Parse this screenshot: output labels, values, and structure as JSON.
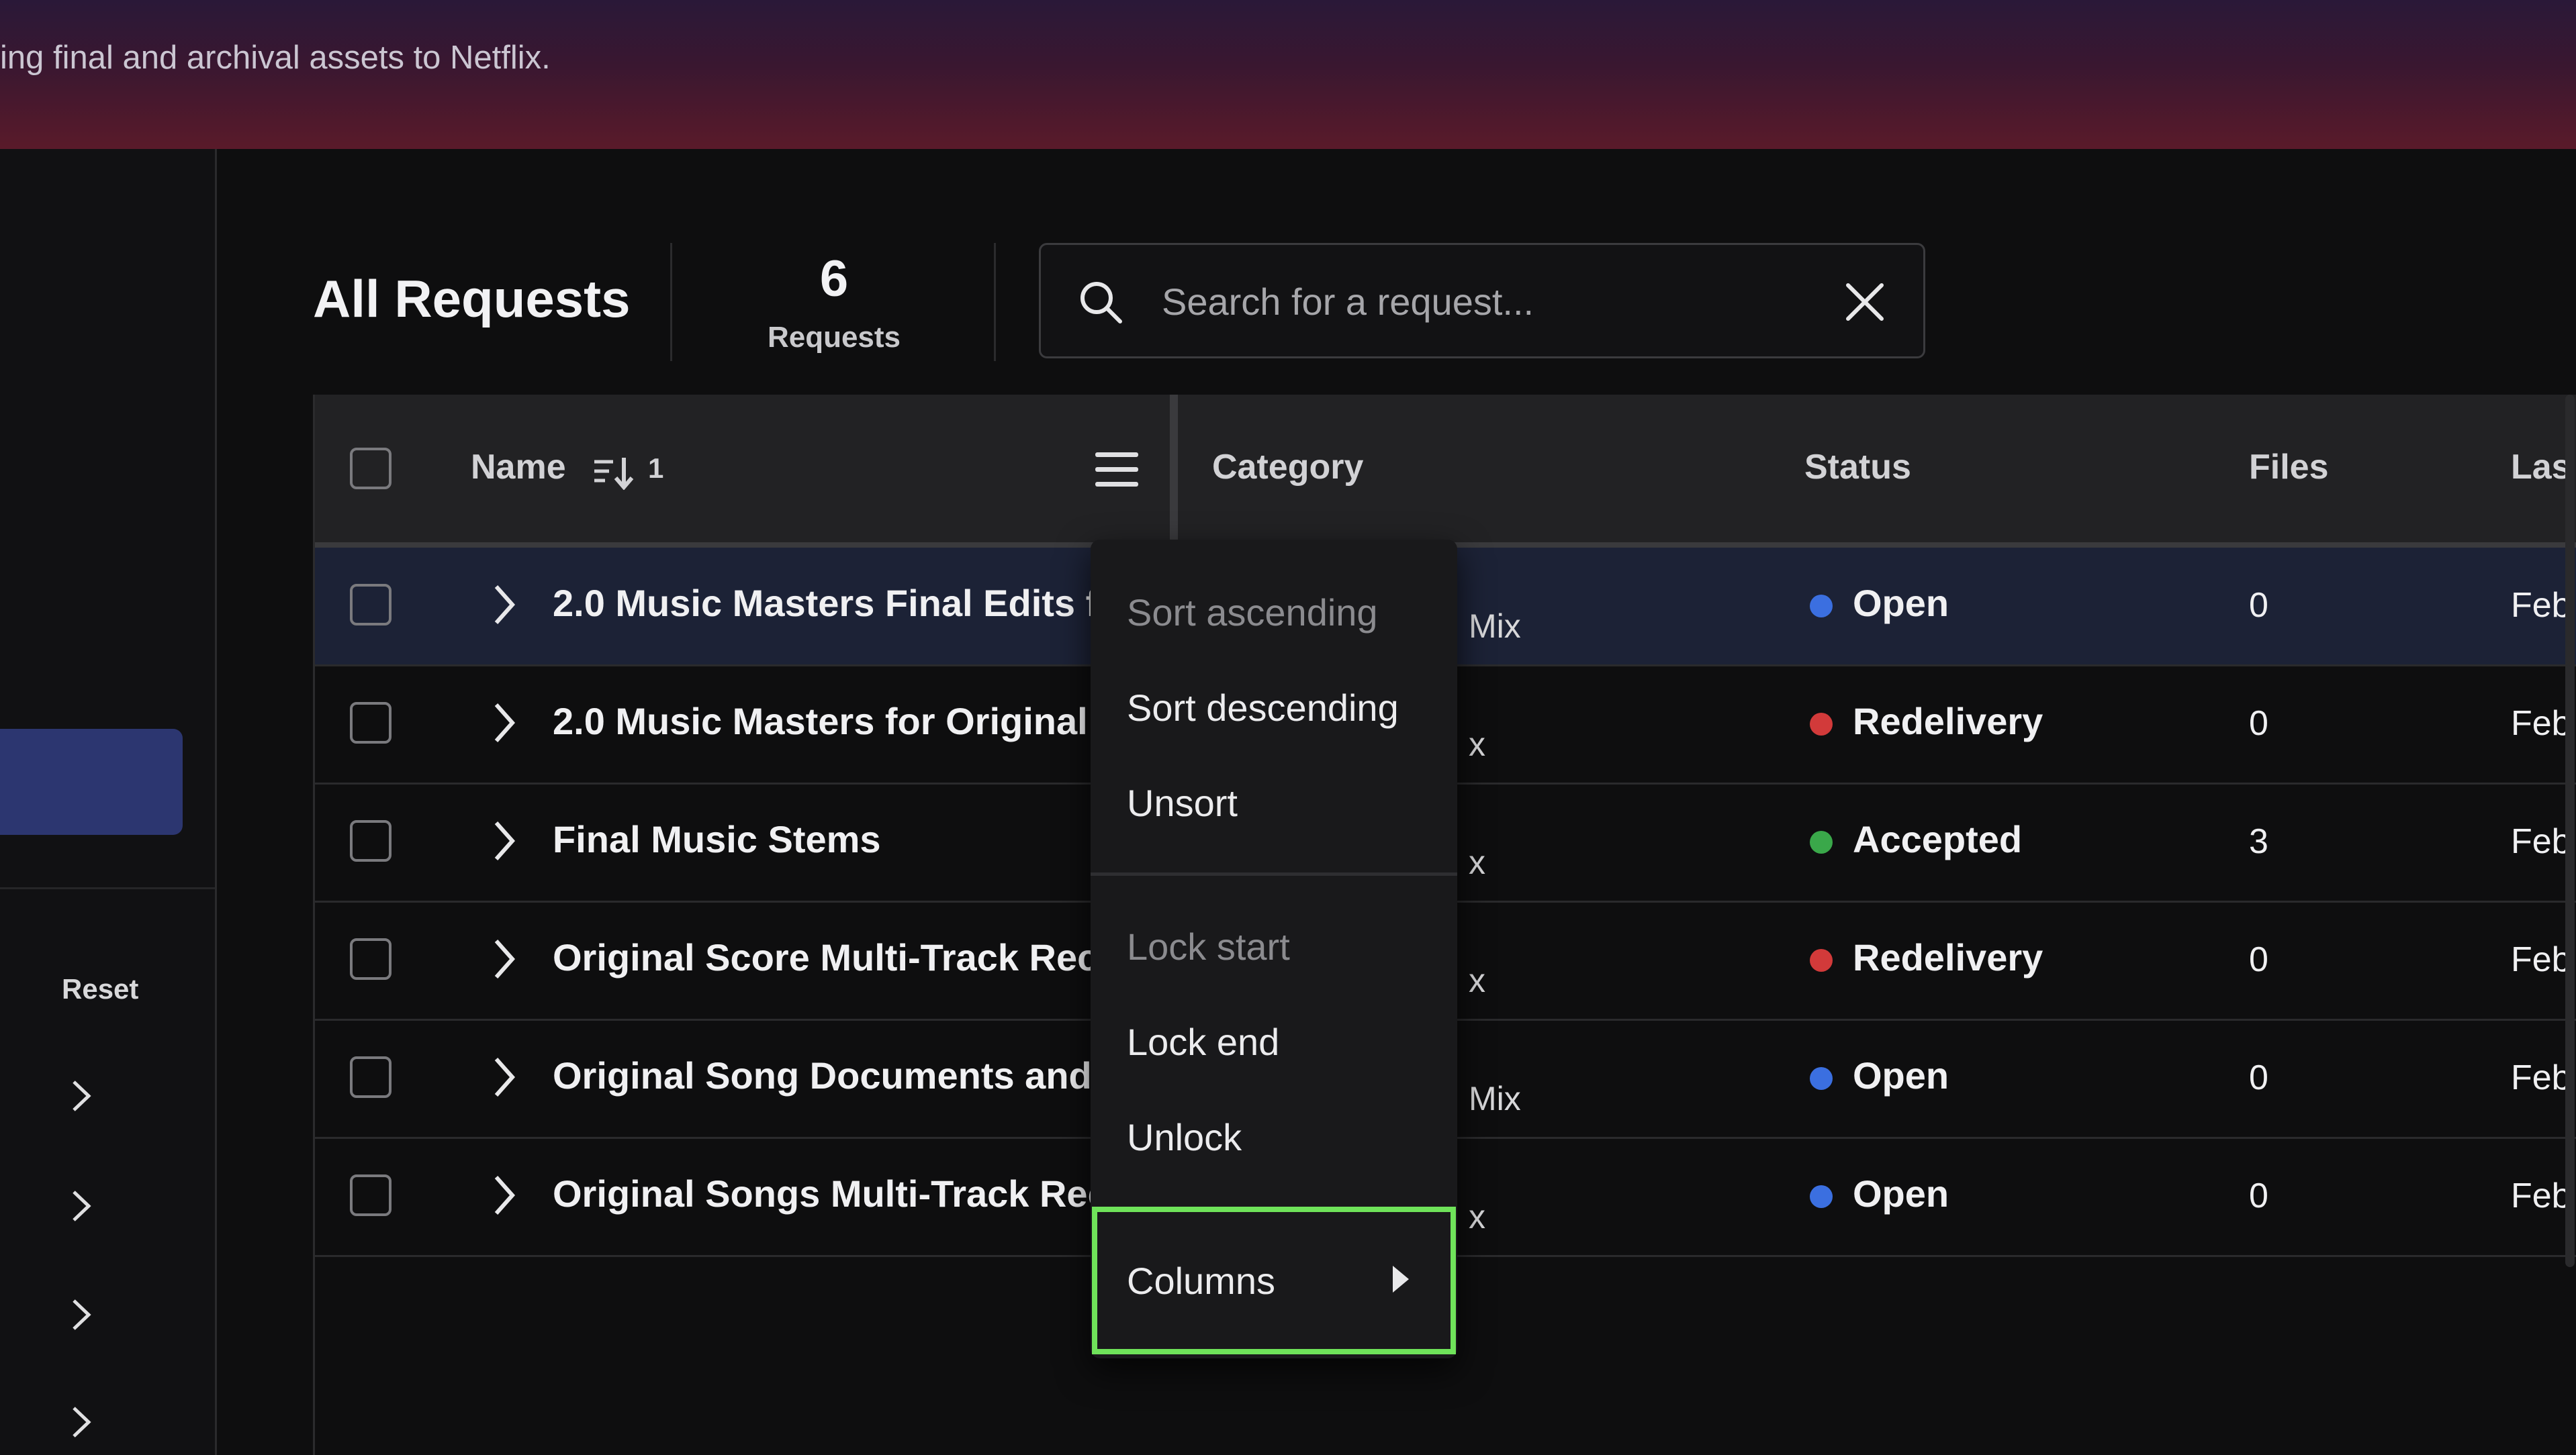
{
  "banner": {
    "text": "ing final and archival assets to Netflix."
  },
  "sidebar": {
    "reset_label": "Reset"
  },
  "header": {
    "title": "All Requests",
    "count": "6",
    "count_label": "Requests"
  },
  "search": {
    "placeholder": "Search for a request..."
  },
  "table": {
    "columns": {
      "name": "Name",
      "sort_indicator": "1",
      "category": "Category",
      "status": "Status",
      "files": "Files",
      "last": "Las"
    },
    "rows": [
      {
        "name": "2.0 Music Masters Final Edits f...",
        "category": "Mix",
        "status": "Open",
        "status_color": "#3b6fe0",
        "files": "0",
        "last": "Feb"
      },
      {
        "name": "2.0 Music Masters for Original ...",
        "category": "x",
        "status": "Redelivery",
        "status_color": "#d23a3a",
        "files": "0",
        "last": "Feb"
      },
      {
        "name": "Final Music Stems",
        "category": "x",
        "status": "Accepted",
        "status_color": "#3aa84a",
        "files": "3",
        "last": "Feb"
      },
      {
        "name": "Original Score Multi-Track Rec...",
        "category": "x",
        "status": "Redelivery",
        "status_color": "#d23a3a",
        "files": "0",
        "last": "Feb"
      },
      {
        "name": "Original Song Documents and ...",
        "category": "Mix",
        "status": "Open",
        "status_color": "#3b6fe0",
        "files": "0",
        "last": "Feb"
      },
      {
        "name": "Original Songs Multi-Track Rec...",
        "category": "x",
        "status": "Open",
        "status_color": "#3b6fe0",
        "files": "0",
        "last": "Feb"
      }
    ]
  },
  "context_menu": {
    "sort_ascending": "Sort ascending",
    "sort_descending": "Sort descending",
    "unsort": "Unsort",
    "lock_start": "Lock start",
    "lock_end": "Lock end",
    "unlock": "Unlock",
    "columns": "Columns"
  }
}
